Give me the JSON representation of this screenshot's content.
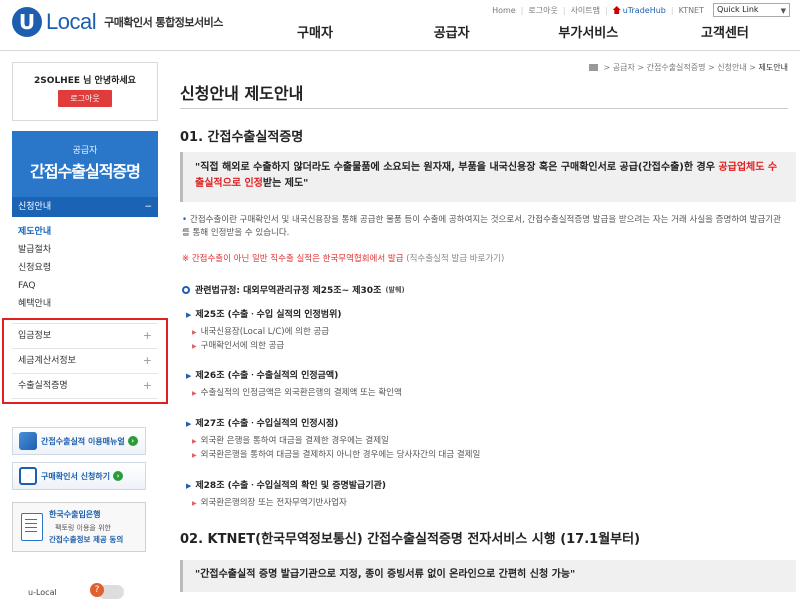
{
  "header": {
    "logo_letter": "U",
    "logo_word": "Local",
    "logo_sub": "구매확인서 통합정보서비스",
    "top_links": [
      "Home",
      "로그아웃",
      "사이트맵"
    ],
    "utrade": "uTradeHub",
    "ktnet": "KTNET",
    "quick_link": "Quick Link",
    "gnb": [
      "구매자",
      "공급자",
      "부가서비스",
      "고객센터"
    ]
  },
  "sidebar": {
    "greeting": "2SOLHEE 님 안녕하세요",
    "logout": "로그아웃",
    "category": "공급자",
    "title": "간접수출실적증명",
    "open_section": "신청안내",
    "sub_items": [
      "제도안내",
      "발급절차",
      "신청요령",
      "FAQ",
      "혜택안내"
    ],
    "menu_items": [
      "입금정보",
      "세금계산서정보",
      "수출실적증명"
    ],
    "banners": [
      "간접수출실적 이용매뉴얼",
      "구매확인서 신청하기"
    ],
    "bank_banner": {
      "line1": "한국수출입은행",
      "line2": "팩토링 이용을 위한",
      "line3": "간접수출정보 제공 동의"
    },
    "footer": "u-Local",
    "help": "?"
  },
  "content": {
    "breadcrumb": [
      "공급자",
      "간접수출실적증명",
      "신청안내",
      "제도안내"
    ],
    "page_title": "신청안내 제도안내",
    "section1_title": "01. 간접수출실적증명",
    "quote1_part1": "\"직접 해외로 수출하지 않더라도 수출물품에 소요되는 원자재, 부품을 내국신용장 혹은 구매확인서로 공급(간접수출)한 경우 ",
    "quote1_red": "공급업체도 수출실적으로 인정",
    "quote1_part2": "받는 제도\"",
    "description": "간접수출이란 구매확인서 및 내국신용장을 통해 공급한 물품 등이 수출에 공하여지는 것으로서, 간접수출실적증명 발급을 받으려는 자는 거래 사실을 증명하여 발급기관를 통해 인정받을 수 있습니다.",
    "notice_red": "※ 간접수출이 아닌 일반 직수출 실적은 한국무역협회에서 발급",
    "notice_gray": "(직수출실적 발급 바로가기)",
    "regulation": "관련법규정: 대외무역관리규정 제25조~ 제30조",
    "regulation_badge": "(발췌)",
    "articles": [
      {
        "title": "제25조 (수출ㆍ수입 실적의 인정범위)",
        "bullets": [
          "내국신용장(Local L/C)에 의한 공급",
          "구매확인서에 의한 공급"
        ]
      },
      {
        "title": "제26조 (수출ㆍ수출실적의 인정금액)",
        "bullets": [
          "수출실적의 인정금액은 외국환은행의 결제액 또는 확인액"
        ]
      },
      {
        "title": "제27조 (수출ㆍ수입실적의 인정시점)",
        "bullets": [
          "외국환 은행을 통하여 대금을 결제한 경우에는 결제일",
          "외국환은행을 통하여 대금을 결제하지 아니한 경우에는 당사자간의 대금 결제일"
        ]
      },
      {
        "title": "제28조 (수출ㆍ수입실적의 확인 및 증명발급기관)",
        "bullets": [
          "외국환은행의장 또는 전자무역기반사업자"
        ]
      }
    ],
    "section2_title": "02. KTNET(한국무역정보통신) 간접수출실적증명 전자서비스 시행 (17.1월부터)",
    "quote2": "\"간접수출실적 증명 발급기관으로 지정, 종이 증빙서류 없이 온라인으로 간편히 신청 가능\""
  }
}
